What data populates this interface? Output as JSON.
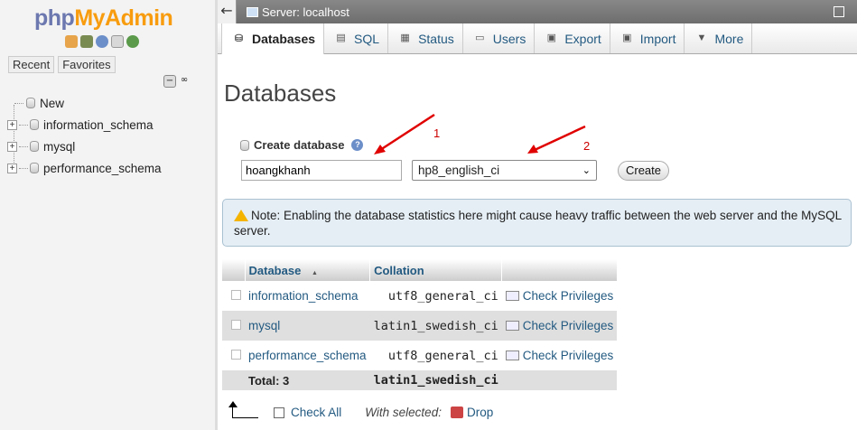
{
  "navigation": {
    "logo": {
      "php": "php",
      "myadmin": "MyAdmin"
    },
    "quick_icons": [
      "home-icon",
      "logout-icon",
      "help-icon",
      "docs-icon",
      "reload-icon"
    ],
    "tabs": {
      "recent": "Recent",
      "favorites": "Favorites"
    },
    "tree": [
      {
        "label": "New",
        "expandable": false
      },
      {
        "label": "information_schema",
        "expandable": true
      },
      {
        "label": "mysql",
        "expandable": true
      },
      {
        "label": "performance_schema",
        "expandable": true
      }
    ]
  },
  "topbar": {
    "back_glyph": "←",
    "server_label": "Server: localhost"
  },
  "tabs": [
    {
      "label": "Databases",
      "icon": "database-icon",
      "active": true
    },
    {
      "label": "SQL",
      "icon": "sql-icon"
    },
    {
      "label": "Status",
      "icon": "status-icon"
    },
    {
      "label": "Users",
      "icon": "users-icon"
    },
    {
      "label": "Export",
      "icon": "export-icon"
    },
    {
      "label": "Import",
      "icon": "import-icon"
    },
    {
      "label": "More",
      "icon": "chevron-down-icon"
    }
  ],
  "page": {
    "title": "Databases",
    "create": {
      "label": "Create database",
      "name_value": "hoangkhanh",
      "collation_value": "hp8_english_ci",
      "button": "Create"
    },
    "annotations": {
      "one": "1",
      "two": "2"
    },
    "note": "Note: Enabling the database statistics here might cause heavy traffic between the web server and the MySQL server."
  },
  "table": {
    "headers": {
      "database": "Database",
      "sort_glyph": "▲",
      "collation": "Collation"
    },
    "rows": [
      {
        "name": "information_schema",
        "collation": "utf8_general_ci",
        "action": "Check Privileges"
      },
      {
        "name": "mysql",
        "collation": "latin1_swedish_ci",
        "action": "Check Privileges"
      },
      {
        "name": "performance_schema",
        "collation": "utf8_general_ci",
        "action": "Check Privileges"
      }
    ],
    "total": {
      "label": "Total: 3",
      "collation": "latin1_swedish_ci"
    }
  },
  "footer": {
    "check_all": "Check All",
    "with_selected": "With selected:",
    "drop": "Drop"
  },
  "colors": {
    "link": "#235a81",
    "logo_php": "#6c78af",
    "logo_myadmin": "#f89c0e",
    "annotation": "#e00000"
  }
}
